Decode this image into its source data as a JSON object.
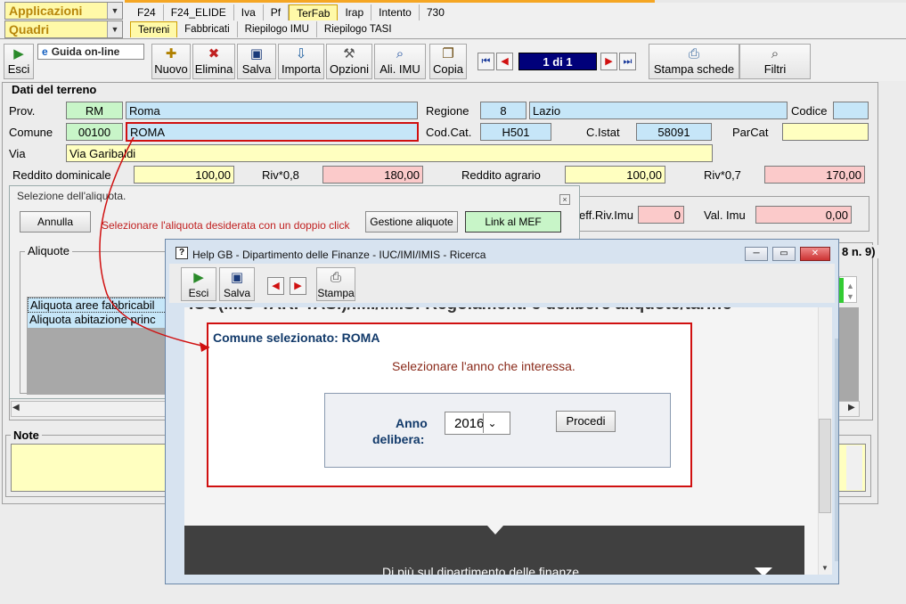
{
  "top": {
    "applicazioni": "Applicazioni",
    "quadri": "Quadri",
    "tabs": [
      "F24",
      "F24_ELIDE",
      "Iva",
      "Pf",
      "TerFab",
      "Irap",
      "Intento",
      "730"
    ],
    "subtabs": [
      "Terreni",
      "Fabbricati",
      "Riepilogo IMU",
      "Riepilogo TASI"
    ]
  },
  "toolbar": {
    "esci": "Esci",
    "guida": "Guida on-line",
    "nuovo": "Nuovo",
    "elimina": "Elimina",
    "salva": "Salva",
    "importa": "Importa",
    "opzioni": "Opzioni",
    "ali_imu": "Ali. IMU",
    "copia": "Copia",
    "pager": "1 di 1",
    "stampa": "Stampa schede",
    "filtri": "Filtri"
  },
  "terreno": {
    "section": "Dati del terreno",
    "prov_label": "Prov.",
    "prov": "RM",
    "prov_name": "Roma",
    "regione_label": "Regione",
    "regione_code": "8",
    "regione": "Lazio",
    "codice_label": "Codice",
    "codice": "",
    "comune_label": "Comune",
    "comune_code": "00100",
    "comune": "ROMA",
    "codcat_label": "Cod.Cat.",
    "codcat": "H501",
    "cistat_label": "C.Istat",
    "cistat": "58091",
    "parcat_label": "ParCat",
    "parcat": "",
    "via_label": "Via",
    "via": "Via Garibaldi",
    "rd_label": "Reddito dominicale",
    "rd": "100,00",
    "riv08_label": "Riv*0,8",
    "riv08": "180,00",
    "ra_label": "Reddito agrario",
    "ra": "100,00",
    "riv07_label": "Riv*0,7",
    "riv07": "170,00",
    "coeff_label": "eff.Riv.Imu",
    "coeff": "0",
    "valimu_label": "Val. Imu",
    "valimu": "0,00",
    "aliquote_label": "Aliquote",
    "n9": "8 n. 9)",
    "note_label": "Note"
  },
  "aliquota_dialog": {
    "title": "Selezione dell'aliquota.",
    "annulla": "Annulla",
    "message": "Selezionare l'aliquota desiderata con un doppio click",
    "gestione": "Gestione aliquote",
    "link_mef": "Link al MEF",
    "rows": [
      "Aliquota aree fabbricabil",
      "Aliquota abitazione princ"
    ]
  },
  "help": {
    "title": "Help GB - Dipartimento delle Finanze - IUC/IMI/IMIS - Ricerca",
    "esci": "Esci",
    "salva": "Salva",
    "stampa": "Stampa",
    "heading": "IUC(IMU-TARI-TASI)/IMI/IMIS: Regolamenti e delibere aliquote/tariffe",
    "comune_sel": "Comune selezionato: ROMA",
    "instruction": "Selezionare l'anno che interessa.",
    "anno_label1": "Anno",
    "anno_label2": "delibera:",
    "anno_value": "2016",
    "procedi": "Procedi",
    "footer": "Di più sul dipartimento delle finanze"
  },
  "colors": {
    "pager_bg": "#00007a",
    "highlight_red": "#d01010",
    "help_blue": "#123a6a"
  }
}
